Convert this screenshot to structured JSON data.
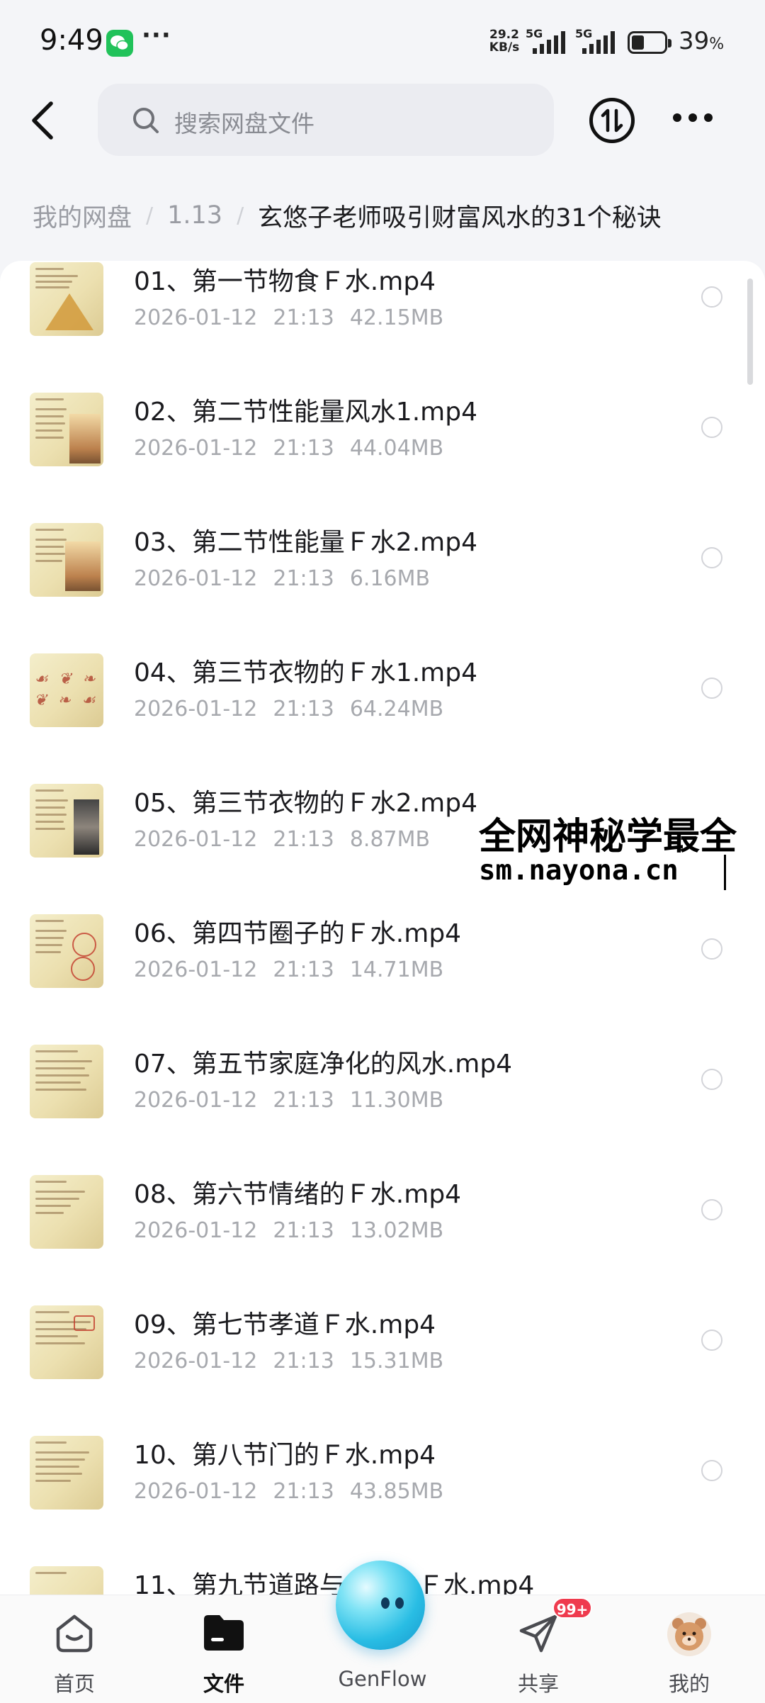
{
  "status_bar": {
    "time": "9:49",
    "more": "···",
    "net_speed_value": "29.2",
    "net_speed_unit": "KB/s",
    "signal_1": "5G",
    "signal_2": "5G",
    "battery_level": 0.39,
    "battery_value": "39",
    "battery_unit": "%"
  },
  "header": {
    "search_placeholder": "搜索网盘文件",
    "icons": {
      "back": "back-arrow-icon",
      "search": "search-icon",
      "transfer": "transfer-icon",
      "more": "more-icon"
    }
  },
  "breadcrumb": {
    "items": [
      "我的网盘",
      "1.13"
    ],
    "separator": "/",
    "current": "玄悠子老师吸引财富风水的31个秘诀"
  },
  "files": [
    {
      "name": "01、第一节物食Ｆ水.mp4",
      "date": "2026-01-12",
      "time": "21:13",
      "size": "42.15MB"
    },
    {
      "name": "02、第二节性能量风水1.mp4",
      "date": "2026-01-12",
      "time": "21:13",
      "size": "44.04MB"
    },
    {
      "name": "03、第二节性能量Ｆ水2.mp4",
      "date": "2026-01-12",
      "time": "21:13",
      "size": "6.16MB"
    },
    {
      "name": "04、第三节衣物的Ｆ水1.mp4",
      "date": "2026-01-12",
      "time": "21:13",
      "size": "64.24MB"
    },
    {
      "name": "05、第三节衣物的Ｆ水2.mp4",
      "date": "2026-01-12",
      "time": "21:13",
      "size": "8.87MB"
    },
    {
      "name": "06、第四节圈子的Ｆ水.mp4",
      "date": "2026-01-12",
      "time": "21:13",
      "size": "14.71MB"
    },
    {
      "name": "07、第五节家庭净化的风水.mp4",
      "date": "2026-01-12",
      "time": "21:13",
      "size": "11.30MB"
    },
    {
      "name": "08、第六节情绪的Ｆ水.mp4",
      "date": "2026-01-12",
      "time": "21:13",
      "size": "13.02MB"
    },
    {
      "name": "09、第七节孝道Ｆ水.mp4",
      "date": "2026-01-12",
      "time": "21:13",
      "size": "15.31MB"
    },
    {
      "name": "10、第八节门的Ｆ水.mp4",
      "date": "2026-01-12",
      "time": "21:13",
      "size": "43.85MB"
    },
    {
      "name": "11、第九节道路与",
      "name_tail": "Ｆ水.mp4"
    }
  ],
  "watermark": {
    "line1": "全网神秘学最全",
    "line2": "sm.nayona.cn"
  },
  "bottom_nav": {
    "items": [
      {
        "label": "首页",
        "icon": "home-icon"
      },
      {
        "label": "文件",
        "icon": "folder-icon",
        "active": true
      },
      {
        "label": "GenFlow",
        "icon": "genflow-orb-icon"
      },
      {
        "label": "共享",
        "icon": "share-icon"
      },
      {
        "label": "我的",
        "icon": "avatar-icon"
      }
    ],
    "share_badge": "99+"
  },
  "colors": {
    "background": "#f4f5f8",
    "list_background": "#ffffff",
    "text_primary": "#1b1b1f",
    "text_secondary": "#a7a9ae",
    "badge": "#ef3b4e",
    "genflow": "#29bde4"
  }
}
